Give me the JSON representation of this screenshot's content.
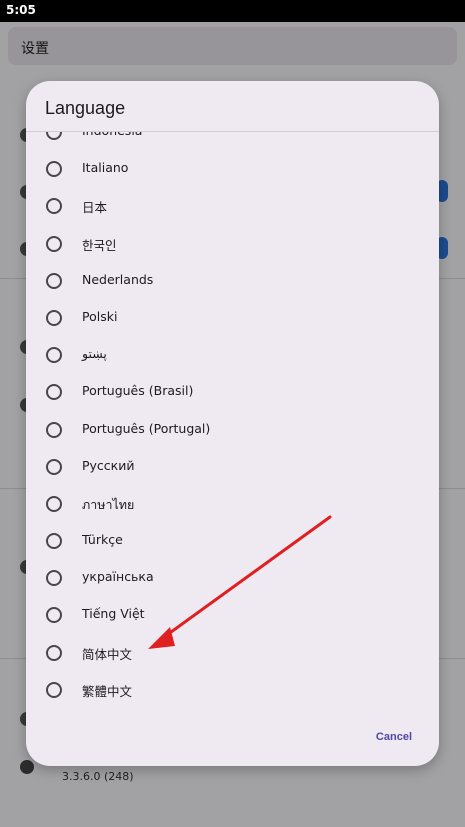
{
  "status_bar": {
    "time": "5:05"
  },
  "background": {
    "search_label": "设置",
    "version": "3.3.6.0 (248)"
  },
  "dialog": {
    "title": "Language",
    "cancel_label": "Cancel",
    "items": [
      {
        "label": "Indonesia"
      },
      {
        "label": "Italiano"
      },
      {
        "label": "日本"
      },
      {
        "label": "한국인"
      },
      {
        "label": "Nederlands"
      },
      {
        "label": "Polski"
      },
      {
        "label": "پښتو"
      },
      {
        "label": "Português (Brasil)"
      },
      {
        "label": "Português (Portugal)"
      },
      {
        "label": "Русский"
      },
      {
        "label": "ภาษาไทย"
      },
      {
        "label": "Türkçe"
      },
      {
        "label": "українська"
      },
      {
        "label": "Tiếng Việt"
      },
      {
        "label": "简体中文"
      },
      {
        "label": "繁體中文"
      }
    ]
  },
  "colors": {
    "dialog_bg": "#efe9f2",
    "accent": "#4f48a8",
    "annotation": "#e02020"
  }
}
